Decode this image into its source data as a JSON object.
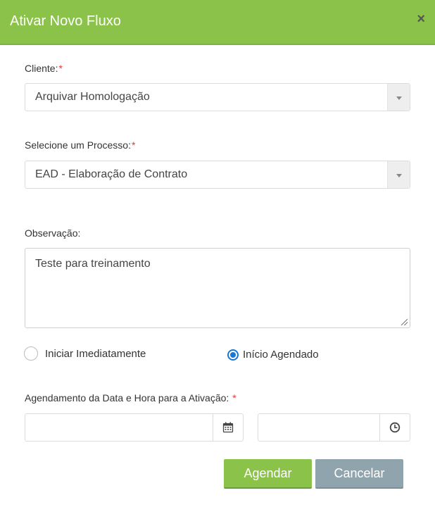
{
  "dialog": {
    "title": "Ativar Novo Fluxo",
    "close_label": "×"
  },
  "form": {
    "required_mark": "*",
    "cliente": {
      "label": "Cliente:",
      "selected": "Arquivar Homologação"
    },
    "processo": {
      "label": "Selecione um Processo:",
      "selected": "EAD - Elaboração de Contrato"
    },
    "observacao": {
      "label": "Observação:",
      "value": "Teste para treinamento"
    },
    "inicio": {
      "options": [
        {
          "label": "Iniciar Imediatamente",
          "checked": false
        },
        {
          "label": "Início Agendado",
          "checked": true
        }
      ]
    },
    "agendamento": {
      "label": "Agendamento da Data e Hora para a Ativação:",
      "date_value": "",
      "time_value": ""
    }
  },
  "actions": {
    "submit_label": "Agendar",
    "cancel_label": "Cancelar"
  },
  "colors": {
    "header": "#8bc34a",
    "primary_button": "#8bc34a",
    "secondary_button": "#90a4ae",
    "radio_checked": "#1976d2",
    "required": "#e53935"
  }
}
